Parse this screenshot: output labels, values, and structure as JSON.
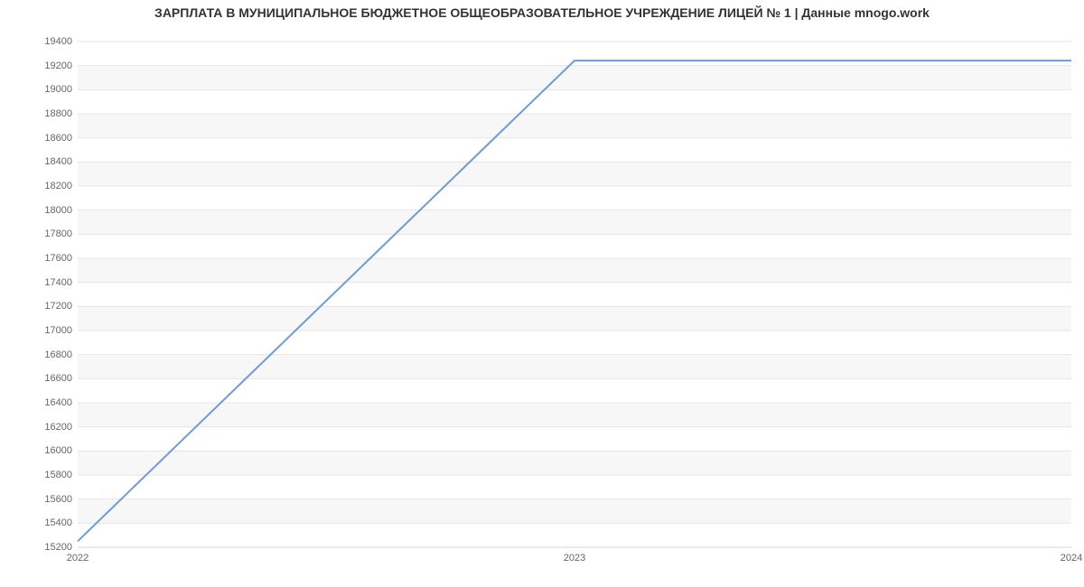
{
  "chart_data": {
    "type": "line",
    "title": "ЗАРПЛАТА В МУНИЦИПАЛЬНОЕ БЮДЖЕТНОЕ ОБЩЕОБРАЗОВАТЕЛЬНОЕ УЧРЕЖДЕНИЕ ЛИЦЕЙ № 1 | Данные mnogo.work",
    "xlabel": "",
    "ylabel": "",
    "x_ticks": [
      "2022",
      "2023",
      "2024"
    ],
    "y_ticks": [
      15200,
      15400,
      15600,
      15800,
      16000,
      16200,
      16400,
      16600,
      16800,
      17000,
      17200,
      17400,
      17600,
      17800,
      18000,
      18200,
      18400,
      18600,
      18800,
      19000,
      19200,
      19400
    ],
    "ylim": [
      15200,
      19400
    ],
    "x": [
      2022,
      2023,
      2024
    ],
    "values": [
      15250,
      19242,
      19242
    ],
    "line_color": "#6e9bd4"
  }
}
